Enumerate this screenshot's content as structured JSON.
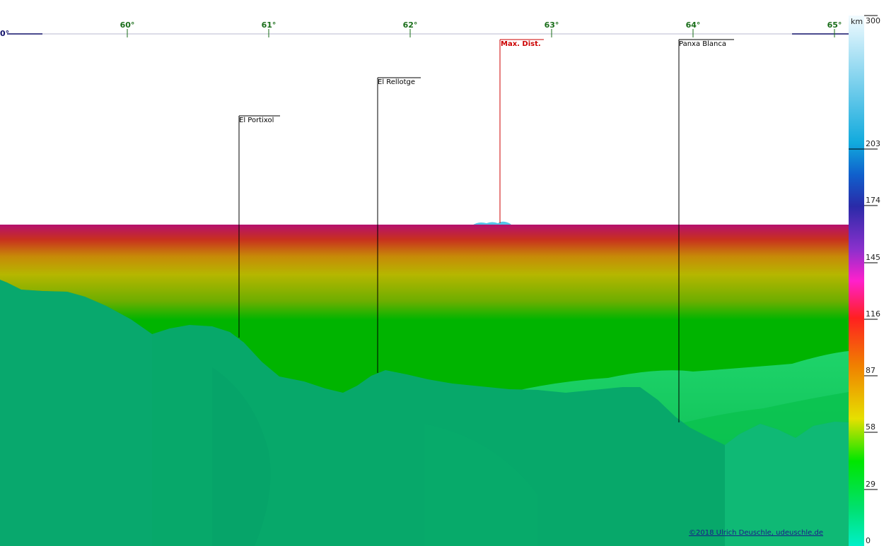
{
  "top_axis": {
    "zero_label": "0°",
    "ticks": [
      "60°",
      "61°",
      "62°",
      "63°",
      "64°",
      "65°"
    ]
  },
  "peaks": [
    {
      "label": "El Portixol",
      "emphasis": false
    },
    {
      "label": "El Rellotge",
      "emphasis": false
    },
    {
      "label": "Max. Dist.",
      "emphasis": true
    },
    {
      "label": "Panxa Blanca",
      "emphasis": false
    }
  ],
  "distance_scale": {
    "unit": "km",
    "ticks": [
      "300",
      "203",
      "174",
      "145",
      "116",
      "87",
      "58",
      "29",
      "0"
    ]
  },
  "credit": "©2018 Ulrich Deuschle, udeuschle.de",
  "colors": {
    "terrain": "#07a86a",
    "band_top": "#b5106e",
    "band_mid": "#b6b600",
    "band_low": "#00b400",
    "peak_red": "#cc0000"
  }
}
